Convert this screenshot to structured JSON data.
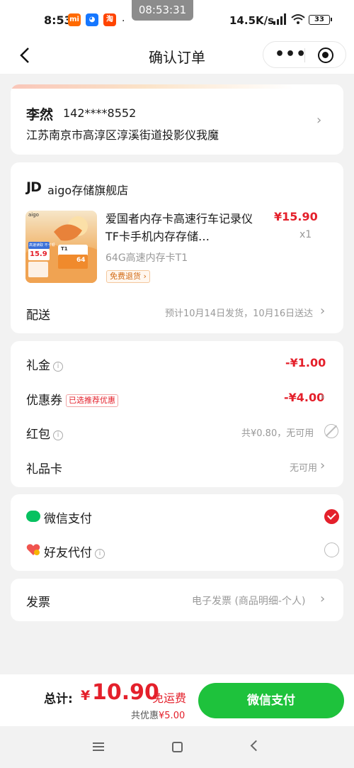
{
  "status_bar": {
    "time": "8:53",
    "center_time": "08:53:31",
    "network_speed": "14.5K/s",
    "battery": "33",
    "app_icons": [
      {
        "name": "xiaomi-icon",
        "glyph": "mi",
        "color": "#ff6a00"
      },
      {
        "name": "app-blue-icon",
        "glyph": "◕",
        "color": "#1677ff"
      },
      {
        "name": "taobao-icon",
        "glyph": "淘",
        "color": "#ff4400"
      }
    ]
  },
  "nav": {
    "title": "确认订单",
    "more_label": "•••"
  },
  "address": {
    "name": "李然",
    "phone": "142****8552",
    "line": "江苏南京市高淳区淳溪街道投影仪我魔"
  },
  "shop": {
    "logo_text": "JD",
    "name": "aigo存储旗舰店"
  },
  "product": {
    "name": "爱国者内存卡高速行车记录仪TF卡手机内存存储…",
    "price": "¥15.90",
    "quantity": "x1",
    "spec": "64G高速内存卡T1",
    "return_tag": "免费退货 ›",
    "thumb_texts": {
      "brand": "aigo",
      "badge": "高速读取 不卡顿",
      "price": "15.9",
      "model": "T1",
      "capacity": "64"
    }
  },
  "shipping": {
    "label": "配送",
    "value": "预计10月14日发货，10月16日送达"
  },
  "discounts": {
    "gift_money": {
      "label": "礼金",
      "value": "-¥1.00"
    },
    "coupon": {
      "label": "优惠券",
      "tag": "已选推荐优惠",
      "value": "-¥4.00"
    },
    "red_packet": {
      "label": "红包",
      "value": "共¥0.80，无可用"
    },
    "gift_card": {
      "label": "礼品卡",
      "value": "无可用"
    }
  },
  "payment": {
    "wechat": {
      "label": "微信支付",
      "selected": true
    },
    "friend": {
      "label": "好友代付",
      "selected": false
    }
  },
  "invoice": {
    "label": "发票",
    "value": "电子发票 (商品明细-个人)"
  },
  "bottom": {
    "total_label": "总计:",
    "currency": "¥",
    "amount": "10.90",
    "free_shipping": "免运费",
    "saved_prefix": "共优惠",
    "saved_amount": "¥5.00",
    "pay_button": "微信支付"
  },
  "colors": {
    "accent_red": "#e4202b",
    "wechat_green": "#1ec23c"
  }
}
